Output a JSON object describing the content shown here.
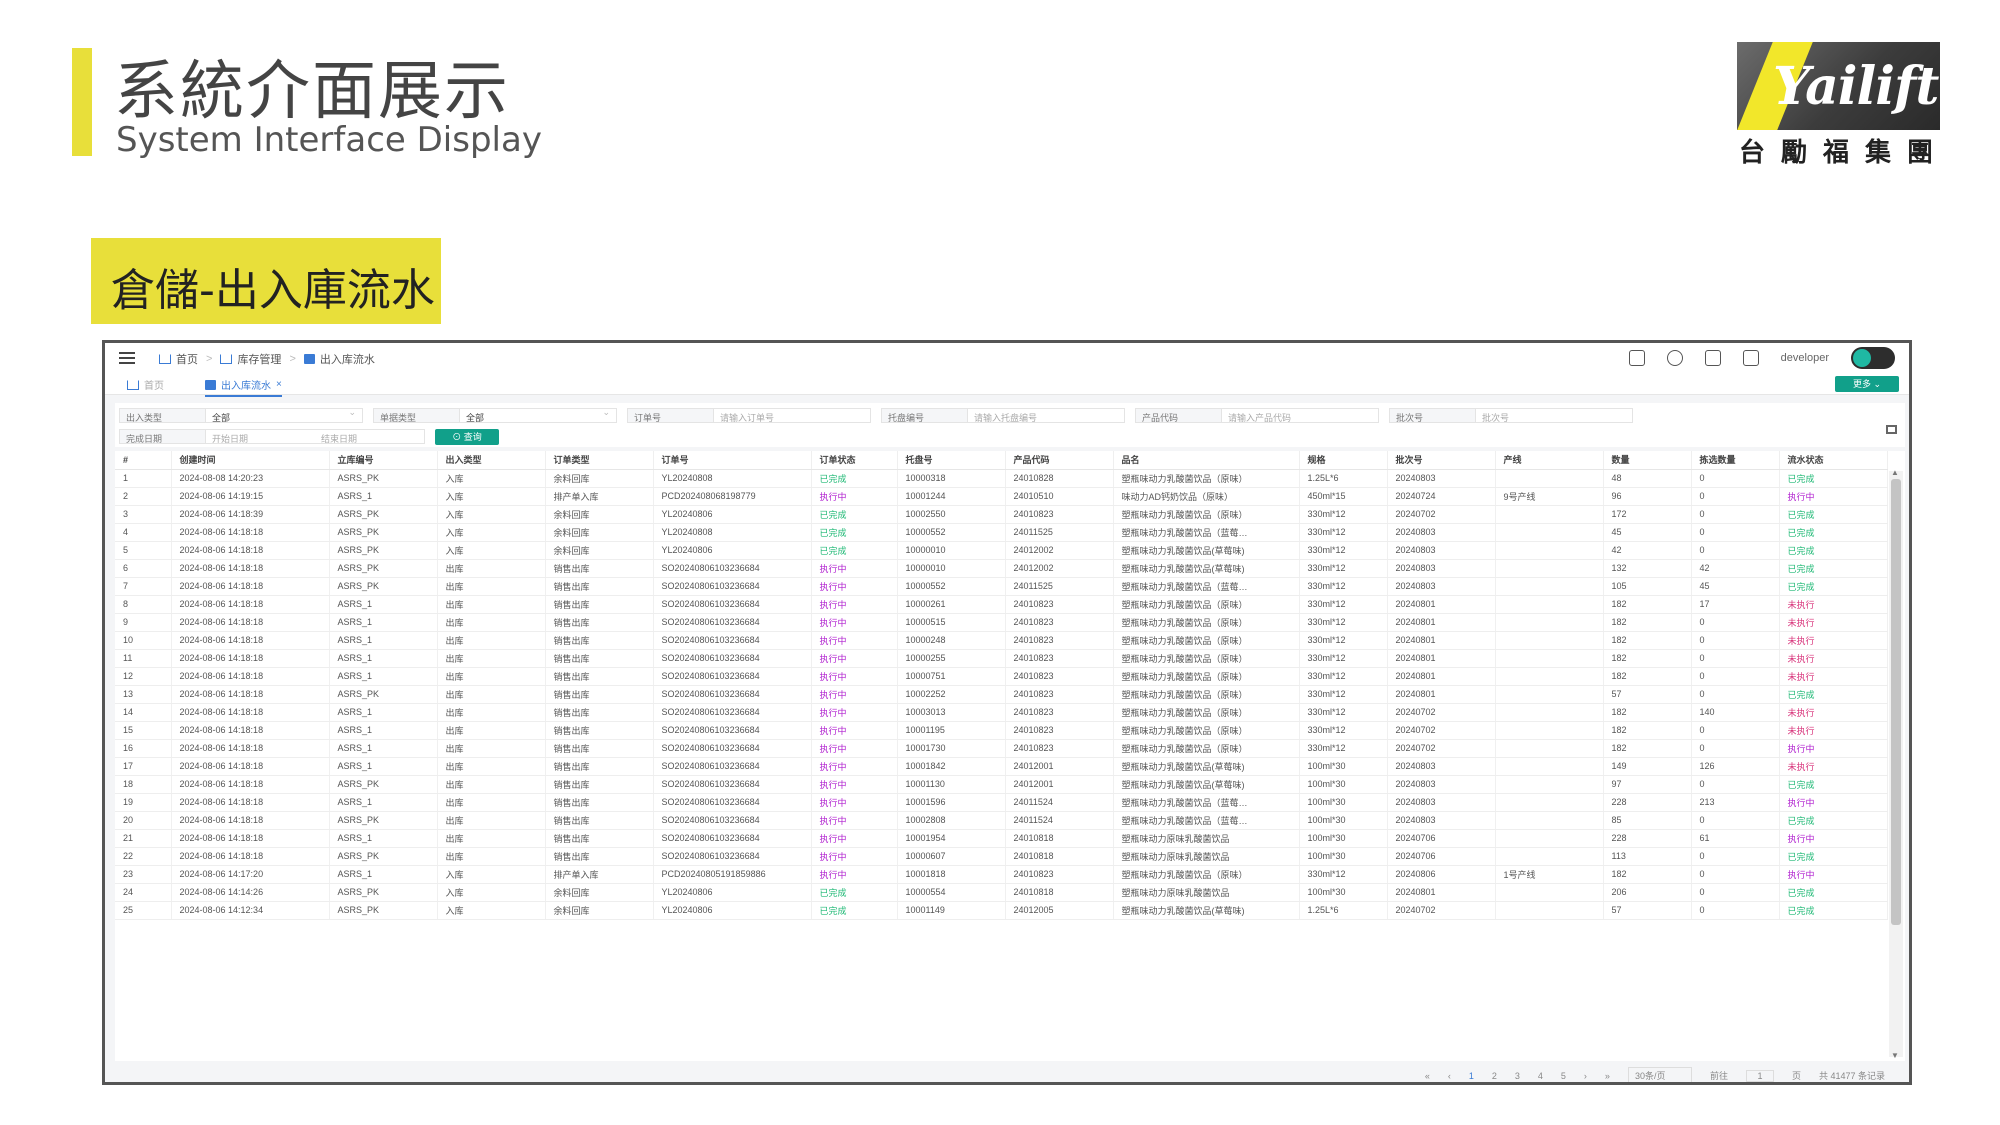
{
  "slide": {
    "title_zh": "系統介面展示",
    "title_en": "System Interface Display",
    "section_tag": "倉儲-出入庫流水",
    "logo": {
      "name": "Yailift",
      "subtitle": "台勵福集團"
    }
  },
  "app": {
    "breadcrumb": [
      "首页",
      "库存管理",
      "出入库流水"
    ],
    "user": "developer",
    "tabs": [
      {
        "label": "首页",
        "active": false
      },
      {
        "label": "出入库流水",
        "active": true
      }
    ],
    "more_label": "更多",
    "filters": [
      {
        "label": "出入类型",
        "value": "全部",
        "type": "select"
      },
      {
        "label": "单据类型",
        "value": "全部",
        "type": "select"
      },
      {
        "label": "订单号",
        "placeholder": "请输入订单号",
        "type": "input"
      },
      {
        "label": "托盘编号",
        "placeholder": "请输入托盘编号",
        "type": "input"
      },
      {
        "label": "产品代码",
        "placeholder": "请输入产品代码",
        "type": "input"
      },
      {
        "label": "批次号",
        "placeholder": "批次号",
        "type": "input"
      }
    ],
    "date_filter": {
      "label": "完成日期",
      "start": "开始日期",
      "end": "结束日期"
    },
    "query_label": "查询",
    "columns": [
      "#",
      "创建时间",
      "立库编号",
      "出入类型",
      "订单类型",
      "订单号",
      "订单状态",
      "托盘号",
      "产品代码",
      "品名",
      "规格",
      "批次号",
      "产线",
      "数量",
      "拣选数量",
      "流水状态"
    ],
    "rows": [
      [
        "1",
        "2024-08-08 14:20:23",
        "ASRS_PK",
        "入库",
        "余料回库",
        "YL20240808",
        "已完成",
        "10000318",
        "24010828",
        "塑瓶味动力乳酸菌饮品（原味）",
        "1.25L*6",
        "20240803",
        "",
        "48",
        "0",
        "已完成"
      ],
      [
        "2",
        "2024-08-06 14:19:15",
        "ASRS_1",
        "入库",
        "排产单入库",
        "PCD202408068198779",
        "执行中",
        "10001244",
        "24010510",
        "味动力AD钙奶饮品（原味）",
        "450ml*15",
        "20240724",
        "9号产线",
        "96",
        "0",
        "执行中"
      ],
      [
        "3",
        "2024-08-06 14:18:39",
        "ASRS_PK",
        "入库",
        "余料回库",
        "YL20240806",
        "已完成",
        "10002550",
        "24010823",
        "塑瓶味动力乳酸菌饮品（原味）",
        "330ml*12",
        "20240702",
        "",
        "172",
        "0",
        "已完成"
      ],
      [
        "4",
        "2024-08-06 14:18:18",
        "ASRS_PK",
        "入库",
        "余料回库",
        "YL20240808",
        "已完成",
        "10000552",
        "24011525",
        "塑瓶味动力乳酸菌饮品（蓝莓…",
        "330ml*12",
        "20240803",
        "",
        "45",
        "0",
        "已完成"
      ],
      [
        "5",
        "2024-08-06 14:18:18",
        "ASRS_PK",
        "入库",
        "余料回库",
        "YL20240806",
        "已完成",
        "10000010",
        "24012002",
        "塑瓶味动力乳酸菌饮品(草莓味)",
        "330ml*12",
        "20240803",
        "",
        "42",
        "0",
        "已完成"
      ],
      [
        "6",
        "2024-08-06 14:18:18",
        "ASRS_PK",
        "出库",
        "销售出库",
        "SO2024080610323668​4",
        "执行中",
        "10000010",
        "24012002",
        "塑瓶味动力乳酸菌饮品(草莓味)",
        "330ml*12",
        "20240803",
        "",
        "132",
        "42",
        "已完成"
      ],
      [
        "7",
        "2024-08-06 14:18:18",
        "ASRS_PK",
        "出库",
        "销售出库",
        "SO20240806103236684",
        "执行中",
        "10000552",
        "24011525",
        "塑瓶味动力乳酸菌饮品（蓝莓…",
        "330ml*12",
        "20240803",
        "",
        "105",
        "45",
        "已完成"
      ],
      [
        "8",
        "2024-08-06 14:18:18",
        "ASRS_1",
        "出库",
        "销售出库",
        "SO20240806103236684",
        "执行中",
        "10000261",
        "24010823",
        "塑瓶味动力乳酸菌饮品（原味）",
        "330ml*12",
        "20240801",
        "",
        "182",
        "17",
        "未执行"
      ],
      [
        "9",
        "2024-08-06 14:18:18",
        "ASRS_1",
        "出库",
        "销售出库",
        "SO20240806103236684",
        "执行中",
        "10000515",
        "24010823",
        "塑瓶味动力乳酸菌饮品（原味）",
        "330ml*12",
        "20240801",
        "",
        "182",
        "0",
        "未执行"
      ],
      [
        "10",
        "2024-08-06 14:18:18",
        "ASRS_1",
        "出库",
        "销售出库",
        "SO20240806103236684",
        "执行中",
        "10000248",
        "24010823",
        "塑瓶味动力乳酸菌饮品（原味）",
        "330ml*12",
        "20240801",
        "",
        "182",
        "0",
        "未执行"
      ],
      [
        "11",
        "2024-08-06 14:18:18",
        "ASRS_1",
        "出库",
        "销售出库",
        "SO20240806103236684",
        "执行中",
        "10000255",
        "24010823",
        "塑瓶味动力乳酸菌饮品（原味）",
        "330ml*12",
        "20240801",
        "",
        "182",
        "0",
        "未执行"
      ],
      [
        "12",
        "2024-08-06 14:18:18",
        "ASRS_1",
        "出库",
        "销售出库",
        "SO20240806103236684",
        "执行中",
        "10000751",
        "24010823",
        "塑瓶味动力乳酸菌饮品（原味）",
        "330ml*12",
        "20240801",
        "",
        "182",
        "0",
        "未执行"
      ],
      [
        "13",
        "2024-08-06 14:18:18",
        "ASRS_PK",
        "出库",
        "销售出库",
        "SO20240806103236684",
        "执行中",
        "10002252",
        "24010823",
        "塑瓶味动力乳酸菌饮品（原味）",
        "330ml*12",
        "20240801",
        "",
        "57",
        "0",
        "已完成"
      ],
      [
        "14",
        "2024-08-06 14:18:18",
        "ASRS_1",
        "出库",
        "销售出库",
        "SO20240806103236684",
        "执行中",
        "10003013",
        "24010823",
        "塑瓶味动力乳酸菌饮品（原味）",
        "330ml*12",
        "20240702",
        "",
        "182",
        "140",
        "未执行"
      ],
      [
        "15",
        "2024-08-06 14:18:18",
        "ASRS_1",
        "出库",
        "销售出库",
        "SO20240806103236684",
        "执行中",
        "10001195",
        "24010823",
        "塑瓶味动力乳酸菌饮品（原味）",
        "330ml*12",
        "20240702",
        "",
        "182",
        "0",
        "未执行"
      ],
      [
        "16",
        "2024-08-06 14:18:18",
        "ASRS_1",
        "出库",
        "销售出库",
        "SO20240806103236684",
        "执行中",
        "10001730",
        "24010823",
        "塑瓶味动力乳酸菌饮品（原味）",
        "330ml*12",
        "20240702",
        "",
        "182",
        "0",
        "执行中"
      ],
      [
        "17",
        "2024-08-06 14:18:18",
        "ASRS_1",
        "出库",
        "销售出库",
        "SO20240806103236684",
        "执行中",
        "10001842",
        "24012001",
        "塑瓶味动力乳酸菌饮品(草莓味)",
        "100ml*30",
        "20240803",
        "",
        "149",
        "126",
        "未执行"
      ],
      [
        "18",
        "2024-08-06 14:18:18",
        "ASRS_PK",
        "出库",
        "销售出库",
        "SO20240806103236684",
        "执行中",
        "10001130",
        "24012001",
        "塑瓶味动力乳酸菌饮品(草莓味)",
        "100ml*30",
        "20240803",
        "",
        "97",
        "0",
        "已完成"
      ],
      [
        "19",
        "2024-08-06 14:18:18",
        "ASRS_1",
        "出库",
        "销售出库",
        "SO20240806103236684",
        "执行中",
        "10001596",
        "24011524",
        "塑瓶味动力乳酸菌饮品（蓝莓…",
        "100ml*30",
        "20240803",
        "",
        "228",
        "213",
        "执行中"
      ],
      [
        "20",
        "2024-08-06 14:18:18",
        "ASRS_PK",
        "出库",
        "销售出库",
        "SO20240806103236684",
        "执行中",
        "10002808",
        "24011524",
        "塑瓶味动力乳酸菌饮品（蓝莓…",
        "100ml*30",
        "20240803",
        "",
        "85",
        "0",
        "已完成"
      ],
      [
        "21",
        "2024-08-06 14:18:18",
        "ASRS_1",
        "出库",
        "销售出库",
        "SO20240806103236684",
        "执行中",
        "10001954",
        "24010818",
        "塑瓶味动力原味乳酸菌饮品",
        "100ml*30",
        "20240706",
        "",
        "228",
        "61",
        "执行中"
      ],
      [
        "22",
        "2024-08-06 14:18:18",
        "ASRS_PK",
        "出库",
        "销售出库",
        "SO20240806103236684",
        "执行中",
        "10000607",
        "24010818",
        "塑瓶味动力原味乳酸菌饮品",
        "100ml*30",
        "20240706",
        "",
        "113",
        "0",
        "已完成"
      ],
      [
        "23",
        "2024-08-06 14:17:20",
        "ASRS_1",
        "入库",
        "排产单入库",
        "PCD20240805191859886",
        "执行中",
        "10001818",
        "24010823",
        "塑瓶味动力乳酸菌饮品（原味）",
        "330ml*12",
        "20240806",
        "1号产线",
        "182",
        "0",
        "执行中"
      ],
      [
        "24",
        "2024-08-06 14:14:26",
        "ASRS_PK",
        "入库",
        "余料回库",
        "YL20240806",
        "已完成",
        "10000554",
        "24010818",
        "塑瓶味动力原味乳酸菌饮品",
        "100ml*30",
        "20240801",
        "",
        "206",
        "0",
        "已完成"
      ],
      [
        "25",
        "2024-08-06 14:12:34",
        "ASRS_PK",
        "入库",
        "余料回库",
        "YL20240806",
        "已完成",
        "10001149",
        "24012005",
        "塑瓶味动力乳酸菌饮品(草莓味)",
        "1.25L*6",
        "20240702",
        "",
        "57",
        "0",
        "已完成"
      ]
    ],
    "pagination": {
      "pages": [
        "1",
        "2",
        "3",
        "4",
        "5"
      ],
      "current": "1",
      "page_size": "30条/页",
      "goto_label": "前往",
      "goto_value": "1",
      "page_unit": "页",
      "total": "共 41477 条记录"
    },
    "status_colors": {
      "已完成": "#1fb975",
      "执行中": "#b01fcf",
      "未执行": "#d8327a"
    }
  }
}
